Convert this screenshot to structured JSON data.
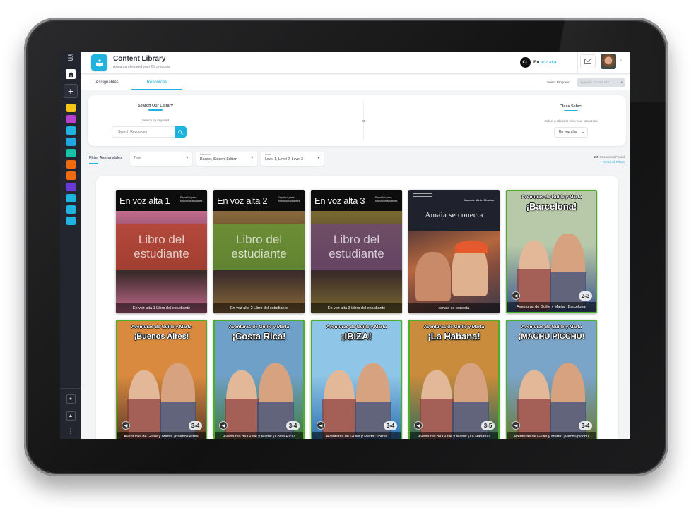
{
  "header": {
    "title": "Content Library",
    "subtitle": "Assign and extend your CL products",
    "brand_prefix": "En",
    "brand_name": "voz alta",
    "brand_logo": "CL"
  },
  "sidebar": {
    "collapse_icon": "⋽",
    "add_label": "+",
    "swatches": [
      "#f5c518",
      "#b63fd0",
      "#1fb3e0",
      "#1fa9e0",
      "#17c4a8",
      "#f26a0f",
      "#f26a0f",
      "#6a3bd1",
      "#1fb3e0",
      "#1fb3e0",
      "#1fb3e0"
    ],
    "more_label": "⋮"
  },
  "tabs": [
    {
      "label": "Assignables",
      "active": false
    },
    {
      "label": "Resources",
      "active": true
    }
  ],
  "program": {
    "label": "Select Program:",
    "value": "Spanish: En voz alta"
  },
  "search": {
    "title": "Search Our Library",
    "hint": "Search by keyword",
    "placeholder": "Search Resources",
    "or_label": "or"
  },
  "class_select": {
    "title": "Class Select",
    "hint": "Select a Class to view your resources",
    "value": "En voz alta"
  },
  "filters": {
    "label": "Filter Assignables",
    "type": {
      "label": "",
      "value": "Type"
    },
    "resource": {
      "label": "Resource",
      "value": "Reader, Student Edition"
    },
    "level": {
      "label": "Level",
      "value": "Level 1, Level 2, Level 3"
    },
    "found_count": "105",
    "found_text": "Resources Found",
    "reset_label": "Reset All Filters"
  },
  "resources": [
    {
      "kind": "textbook",
      "series": "En voz alta 1",
      "sub": "Español para hispanohablantes",
      "band": "Libro del estudiante",
      "caption": "En voz alta 1 Libro del estudiante",
      "band_color": "#b8432f",
      "photo": "#c46b8e"
    },
    {
      "kind": "textbook",
      "series": "En voz alta 2",
      "sub": "Español para hispanohablantes",
      "band": "Libro del estudiante",
      "caption": "En voz alta 2 Libro del estudiante",
      "band_color": "#6a9a34",
      "photo": "#8a6a3a"
    },
    {
      "kind": "textbook",
      "series": "En voz alta 3",
      "sub": "Español para hispanohablantes",
      "band": "Libro del estudiante",
      "caption": "En voz alta 3 Libro del estudiante",
      "band_color": "#6f4a73",
      "photo": "#7a6a30"
    },
    {
      "kind": "novel",
      "author": "Joan de Mirón Montes",
      "title": "Amaia se conecta",
      "caption": "Amaia se conecta"
    },
    {
      "kind": "comic",
      "series": "Aventuras de Guille y Marta",
      "title": "¡Barcelona!",
      "level": "2-3",
      "caption": "Aventuras de Guille y Marta: ¡Barcelona!",
      "sky": "#b7c9a8",
      "ground": "#3e5a8a"
    },
    {
      "kind": "comic",
      "series": "Aventuras de Guille y Marta",
      "title": "¡Buenos Aires!",
      "level": "3-4",
      "caption": "Aventuras de Guille y Marta: ¡Buenos Aires!",
      "sky": "#d98a3e",
      "ground": "#5a3a2a"
    },
    {
      "kind": "comic",
      "series": "Aventuras de Guille y Marta",
      "title": "¡Costa Rica!",
      "level": "3-4",
      "caption": "Aventuras de Guille y Marta: ¡Costa Rica!",
      "sky": "#6fa0c8",
      "ground": "#3f7a3a"
    },
    {
      "kind": "comic",
      "series": "Aventuras de Guille y Marta",
      "title": "¡IBIZA!",
      "level": "3-4",
      "caption": "Aventuras de Guille y Marta: ¡Ibiza!",
      "sky": "#8fc6e8",
      "ground": "#2c6fb0"
    },
    {
      "kind": "comic",
      "series": "Aventuras de Guille y Marta",
      "title": "¡La Habana!",
      "level": "3-5",
      "caption": "Aventuras de Guille y Marta: ¡La Habana!",
      "sky": "#c98b3c",
      "ground": "#2d6a5a"
    },
    {
      "kind": "comic",
      "series": "Aventuras de Guille y Marta",
      "title": "¡MACHU PICCHU!",
      "level": "3-4",
      "caption": "Aventuras de Guille y Marta: ¡Machu picchu!",
      "sky": "#7aa4c8",
      "ground": "#6a7a3a"
    }
  ]
}
